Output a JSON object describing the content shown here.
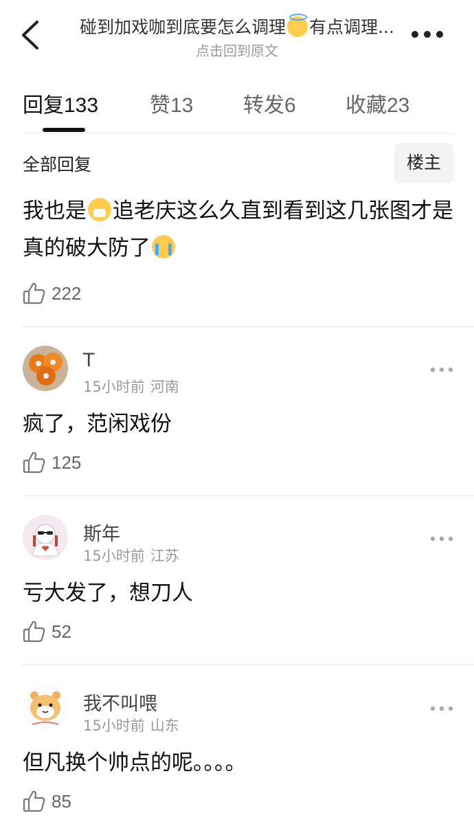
{
  "header": {
    "title_a": "碰到加戏咖到底要怎么调理",
    "title_b": "有点调理...",
    "subtitle": "点击回到原文"
  },
  "tabs": [
    {
      "label": "回复",
      "count": "133"
    },
    {
      "label": "赞",
      "count": "13"
    },
    {
      "label": "转发",
      "count": "6"
    },
    {
      "label": "收藏",
      "count": "23"
    }
  ],
  "section": {
    "title": "全部回复",
    "owner_button": "楼主"
  },
  "main_comment": {
    "text_a": "我也是",
    "text_b": "追老庆这么久直到看到这几张图才是真的破大防了",
    "likes": "222"
  },
  "replies": [
    {
      "name": "T",
      "time": "15小时前",
      "location": "河南",
      "text": "疯了，范闲戏份",
      "likes": "125"
    },
    {
      "name": "斯年",
      "time": "15小时前",
      "location": "江苏",
      "text": "亏大发了，想刀人",
      "likes": "52"
    },
    {
      "name": "我不叫喂",
      "time": "15小时前",
      "location": "山东",
      "text": "但凡换个帅点的呢。。。。",
      "likes": "85"
    }
  ],
  "icons": {
    "back": "back-chevron-icon",
    "more": "more-dots-icon",
    "like": "thumbs-up-icon"
  },
  "colors": {
    "text_primary": "#111111",
    "text_secondary": "#9a9a9a",
    "divider": "#e6e6e6",
    "emoji": "#ffcc4d"
  }
}
